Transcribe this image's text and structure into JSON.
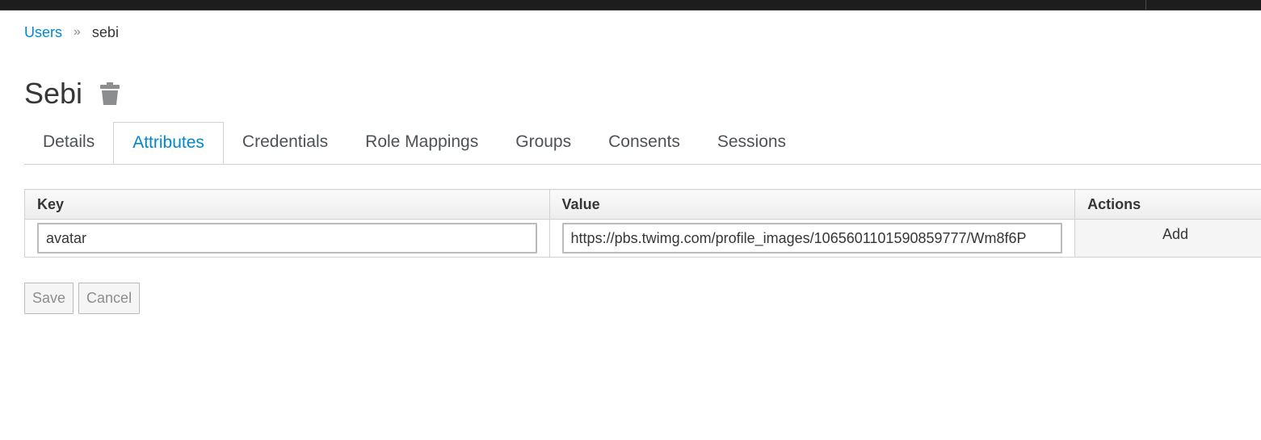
{
  "breadcrumb": {
    "users_label": "Users",
    "separator": "»",
    "current": "sebi"
  },
  "page": {
    "title": "Sebi",
    "delete_icon": "trash-icon"
  },
  "tabs": [
    {
      "label": "Details",
      "active": false
    },
    {
      "label": "Attributes",
      "active": true
    },
    {
      "label": "Credentials",
      "active": false
    },
    {
      "label": "Role Mappings",
      "active": false
    },
    {
      "label": "Groups",
      "active": false
    },
    {
      "label": "Consents",
      "active": false
    },
    {
      "label": "Sessions",
      "active": false
    }
  ],
  "table": {
    "headers": {
      "key": "Key",
      "value": "Value",
      "actions": "Actions"
    },
    "rows": [
      {
        "key": "avatar",
        "value": "https://pbs.twimg.com/profile_images/1065601101590859777/Wm8f6P",
        "action": "Add"
      }
    ]
  },
  "form": {
    "save_label": "Save",
    "cancel_label": "Cancel"
  },
  "colors": {
    "link": "#0088ce",
    "topbar": "#1d1d1d",
    "text": "#363636"
  }
}
